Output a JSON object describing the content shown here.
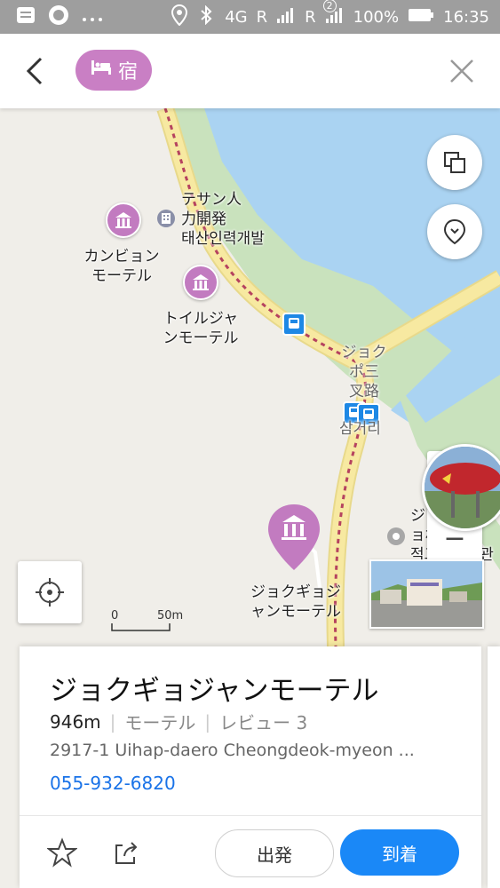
{
  "status_bar": {
    "network": "4G",
    "roaming_1": "R",
    "roaming_2": "R",
    "sim_badge": "2",
    "battery": "100%",
    "time": "16:35"
  },
  "top_bar": {
    "category_chip": "宿",
    "category_icon": "bed-icon"
  },
  "map": {
    "labels": {
      "tesan_ja": "テサン人\n力開発",
      "tesan_ko": "태산인력개발",
      "kangbyon": "カンビョン\nモーテル",
      "toil": "トイルジャ\nンモーテル",
      "jokpo": "ジョク\nポ三\n叉路",
      "samgeori": "삼거리",
      "jogyojang": "ジョクギョジ\nャンモーテル",
      "village_ja": "ジョ\nョ村会館",
      "village_ko": "적교마을회관"
    },
    "scale_zero": "0",
    "scale_dist": "50m",
    "zoom_in": "+",
    "zoom_out": "−",
    "colors": {
      "water": "#aad3f2",
      "road": "#f7e9a1",
      "poi": "#c27bc0",
      "park": "#c9e2bd"
    }
  },
  "place_card": {
    "name": "ジョクギョジャンモーテル",
    "distance": "946m",
    "category": "モーテル",
    "reviews": "レビュー 3",
    "address": "2917-1 Uihap-daero Cheongdeok-myeon ...",
    "phone": "055-932-6820",
    "depart_label": "出発",
    "arrive_label": "到着"
  }
}
